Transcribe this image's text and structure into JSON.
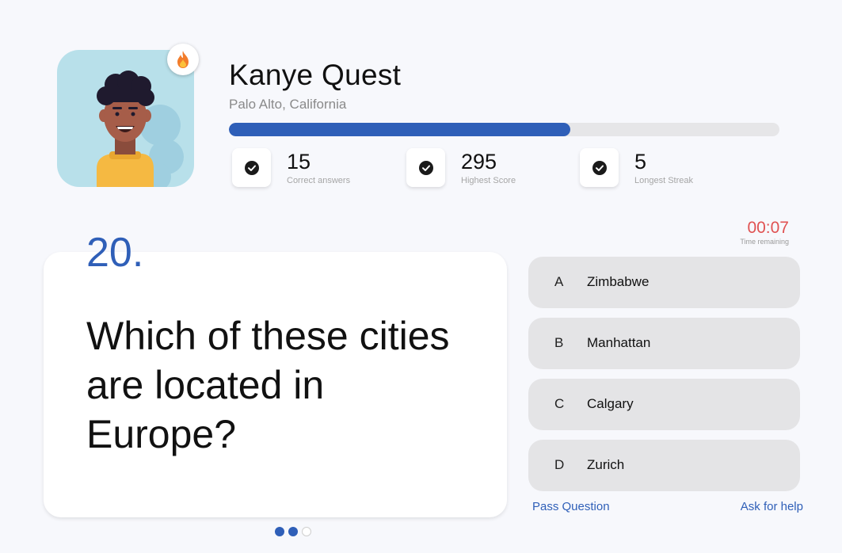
{
  "profile": {
    "name": "Kanye Quest",
    "location": "Palo Alto, California",
    "progress": 0.62,
    "badge_icon": "fire-icon"
  },
  "stats": [
    {
      "value": "15",
      "label": "Correct answers",
      "icon": "check-circle-icon"
    },
    {
      "value": "295",
      "label": "Highest Score",
      "icon": "check-circle-icon"
    },
    {
      "value": "5",
      "label": "Longest Streak",
      "icon": "check-circle-icon"
    }
  ],
  "timer": {
    "value": "00:07",
    "label": "Time remaining"
  },
  "question": {
    "number": "20.",
    "text": "Which of these cities are located in Europe?"
  },
  "answers": [
    {
      "letter": "A",
      "text": "Zimbabwe"
    },
    {
      "letter": "B",
      "text": "Manhattan"
    },
    {
      "letter": "C",
      "text": "Calgary"
    },
    {
      "letter": "D",
      "text": "Zurich"
    }
  ],
  "actions": {
    "pass": "Pass Question",
    "help": "Ask for help"
  },
  "pagination": {
    "total": 3,
    "active": 2
  },
  "colors": {
    "accent": "#2f5fb8",
    "timer": "#e05252",
    "answer_bg": "#e4e4e6",
    "avatar_bg": "#b8e0ea"
  }
}
